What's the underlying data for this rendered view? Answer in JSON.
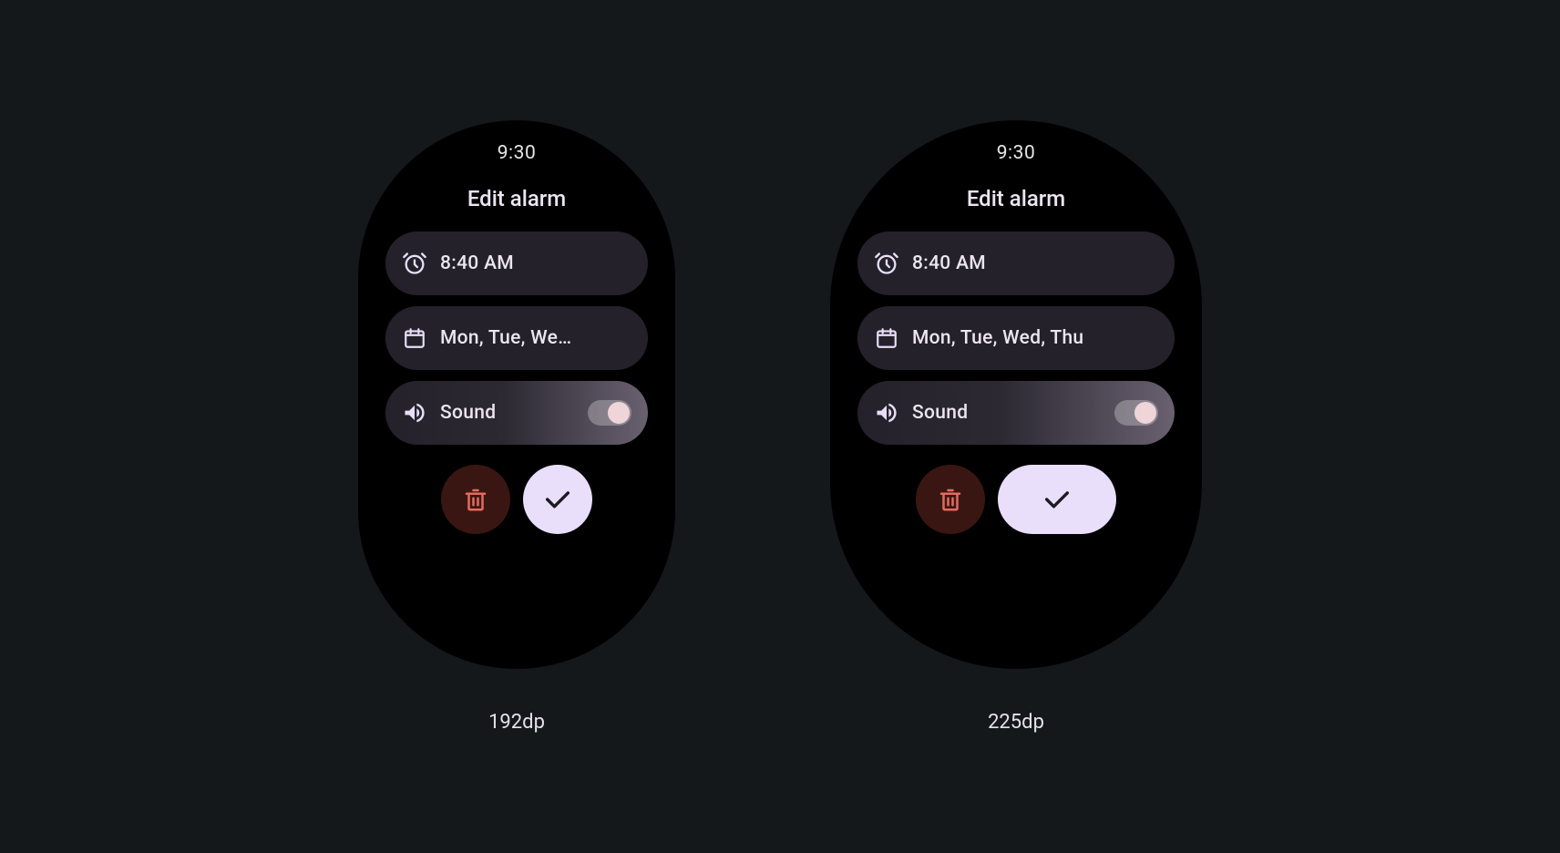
{
  "status_time": "9:30",
  "screen_title": "Edit alarm",
  "alarm_time": "8:40 AM",
  "repeat_days_short": "Mon, Tue, We…",
  "repeat_days_full": "Mon, Tue, Wed, Thu",
  "sound_label": "Sound",
  "sound_enabled": true,
  "mockups": [
    {
      "size_label": "192dp"
    },
    {
      "size_label": "225dp"
    }
  ],
  "colors": {
    "background": "#14181b",
    "watch_bg": "#000000",
    "chip_bg": "#24212a",
    "text": "#ece5f2",
    "confirm_bg": "#e9dffb",
    "delete_bg": "#3a1613",
    "delete_icon": "#e46b5e",
    "toggle_thumb": "#efd5d8"
  }
}
